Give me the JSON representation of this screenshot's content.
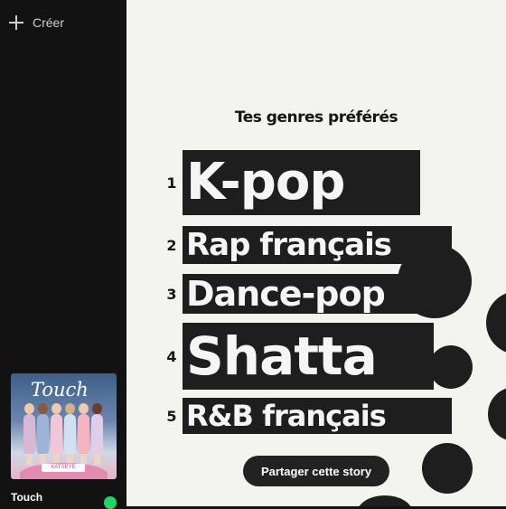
{
  "sidebar": {
    "create_label": "Créer",
    "album_title": "Touch",
    "album_plaque": "KATSEYE",
    "now_playing_title": "Touch"
  },
  "main": {
    "heading": "Tes genres préférés",
    "genres": [
      {
        "rank": "1",
        "name": "K-pop"
      },
      {
        "rank": "2",
        "name": "Rap français"
      },
      {
        "rank": "3",
        "name": "Dance-pop"
      },
      {
        "rank": "4",
        "name": "Shatta"
      },
      {
        "rank": "5",
        "name": "R&B français"
      }
    ],
    "share_label": "Partager cette story"
  },
  "colors": {
    "background": "#f3f3ef",
    "genre_block": "#1e1e1e",
    "sidebar": "#121212",
    "accent_green": "#1ed760"
  },
  "icons": [
    "plus-icon",
    "check-icon"
  ]
}
